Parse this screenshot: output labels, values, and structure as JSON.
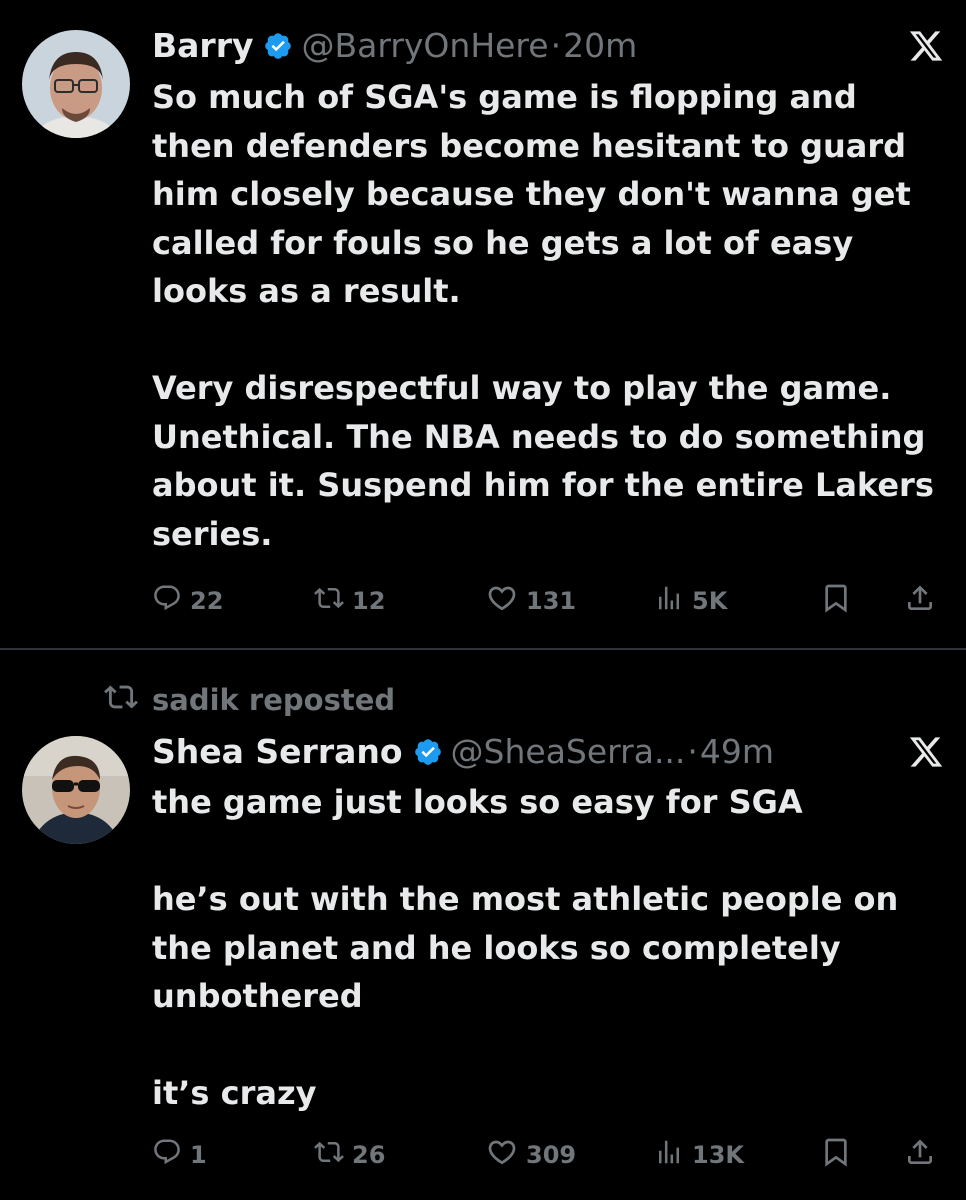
{
  "tweets": [
    {
      "name": "Barry",
      "handle": "@BarryOnHere",
      "separator": "·",
      "time": "20m",
      "text": "So much of SGA's game is flopping and then defenders become hesitant to guard him closely because they don't wanna get called for fouls so he gets a lot of easy looks as a result.\n\nVery disrespectful way to play the game. Unethical. The NBA needs to do something about it. Suspend him for the entire Lakers series.",
      "replies": "22",
      "reposts": "12",
      "likes": "131",
      "views": "5K"
    },
    {
      "repost_label": "sadik reposted",
      "name": "Shea Serrano",
      "handle": "@SheaSerra...",
      "separator": "·",
      "time": "49m",
      "text": "the game just looks so easy for SGA\n\nhe’s out with the most athletic people on the planet and he looks so completely unbothered\n\nit’s crazy",
      "replies": "1",
      "reposts": "26",
      "likes": "309",
      "views": "13K"
    }
  ],
  "colors": {
    "background": "#000000",
    "primary_text": "#e7e9ea",
    "secondary_text": "#71767b",
    "verified_blue": "#1d9bf0",
    "divider": "#2f3336"
  },
  "icons": [
    "verified-badge-icon",
    "x-logo-icon",
    "reply-icon",
    "repost-icon",
    "like-icon",
    "views-icon",
    "bookmark-icon",
    "share-icon"
  ]
}
